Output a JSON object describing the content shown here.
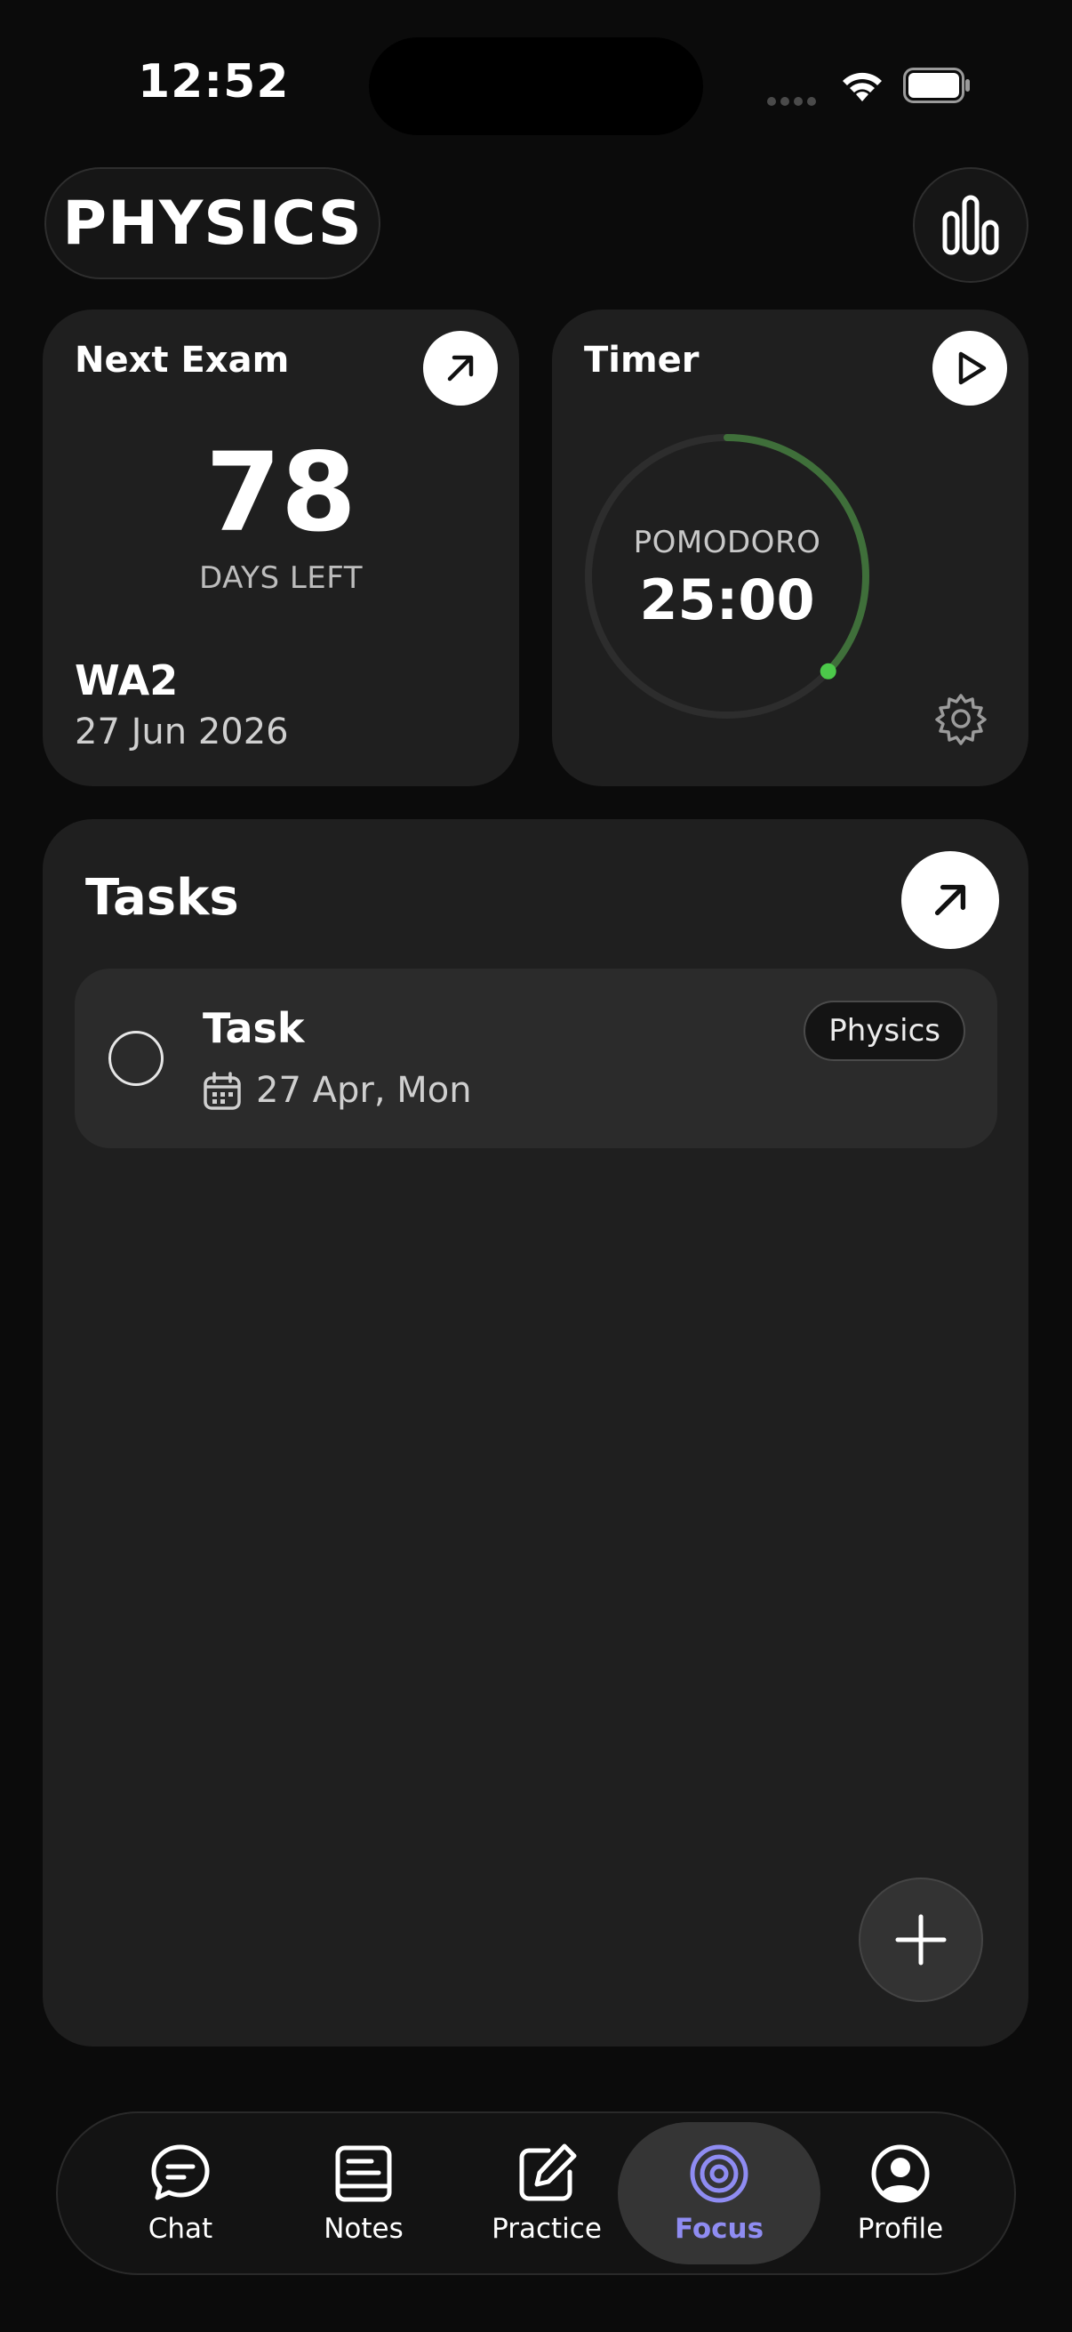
{
  "status_bar": {
    "time": "12:52"
  },
  "header": {
    "subject": "PHYSICS"
  },
  "exam_card": {
    "title": "Next Exam",
    "days": "78",
    "days_label": "DAYS LEFT",
    "exam_name": "WA2",
    "exam_date": "27 Jun 2026"
  },
  "timer_card": {
    "title": "Timer",
    "mode": "POMODORO",
    "time": "25:00",
    "progress": 0.37,
    "ring_color": "#3f6f3a",
    "dot_color": "#4cc94a"
  },
  "tasks": {
    "title": "Tasks",
    "items": [
      {
        "title": "Task",
        "date": "27 Apr, Mon",
        "tag": "Physics"
      }
    ]
  },
  "nav": {
    "items": [
      {
        "label": "Chat",
        "icon": "chat-icon"
      },
      {
        "label": "Notes",
        "icon": "notes-icon"
      },
      {
        "label": "Practice",
        "icon": "practice-icon"
      },
      {
        "label": "Focus",
        "icon": "focus-icon",
        "active": true
      },
      {
        "label": "Profile",
        "icon": "profile-icon"
      }
    ],
    "accent": "#8f8cf2"
  }
}
